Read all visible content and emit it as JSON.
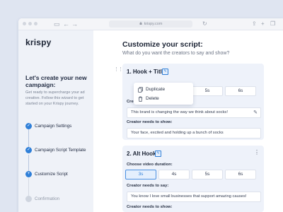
{
  "browser": {
    "url": "krispy.com",
    "back_icon": "arrow-left-icon",
    "forward_icon": "arrow-right-icon",
    "reload_icon": "reload-icon",
    "share_icon": "share-icon",
    "add_tab_icon": "plus-icon",
    "tabs_icon": "tabs-icon"
  },
  "sidebar": {
    "logo": "krispy",
    "title": "Let's create your new campaign:",
    "description": "Get ready to supercharge your ad creative. Follow this wizard to get started on your Krispy journey.",
    "steps": [
      {
        "label": "Campaign Settings",
        "state": "done"
      },
      {
        "label": "Campaign Script Template",
        "state": "done"
      },
      {
        "label": "Customize Script",
        "state": "current"
      },
      {
        "label": "Confirmation",
        "state": "pending"
      }
    ]
  },
  "main": {
    "title": "Customize your script:",
    "subtitle": "What do you want the creators to say and show?",
    "context_menu": {
      "items": [
        {
          "label": "Duplicate",
          "icon": "copy-icon"
        },
        {
          "label": "Delete",
          "icon": "trash-icon"
        }
      ]
    },
    "hooks": [
      {
        "title": "1. Hook + Title",
        "durations_visible": [
          "5s",
          "6s"
        ],
        "say_label": "Creator needs to say:",
        "say_value": "This brand is changing the way we think about socks!",
        "show_label": "Creator needs to show:",
        "show_value": "Your face, excited and holding up a bunch of socks"
      },
      {
        "title": "2. Alt Hook",
        "duration_label": "Choose video duration:",
        "durations": [
          "3s",
          "4s",
          "5s",
          "6s"
        ],
        "selected_duration": "3s",
        "say_label": "Creator needs to say:",
        "say_value": "You know I love small businesses that support amazing causes!",
        "show_label": "Creator needs to show:"
      }
    ]
  },
  "colors": {
    "accent": "#2f7fd8",
    "background": "#dfe5f1",
    "sidebar": "#eff2f8",
    "card": "#eef2fa"
  }
}
